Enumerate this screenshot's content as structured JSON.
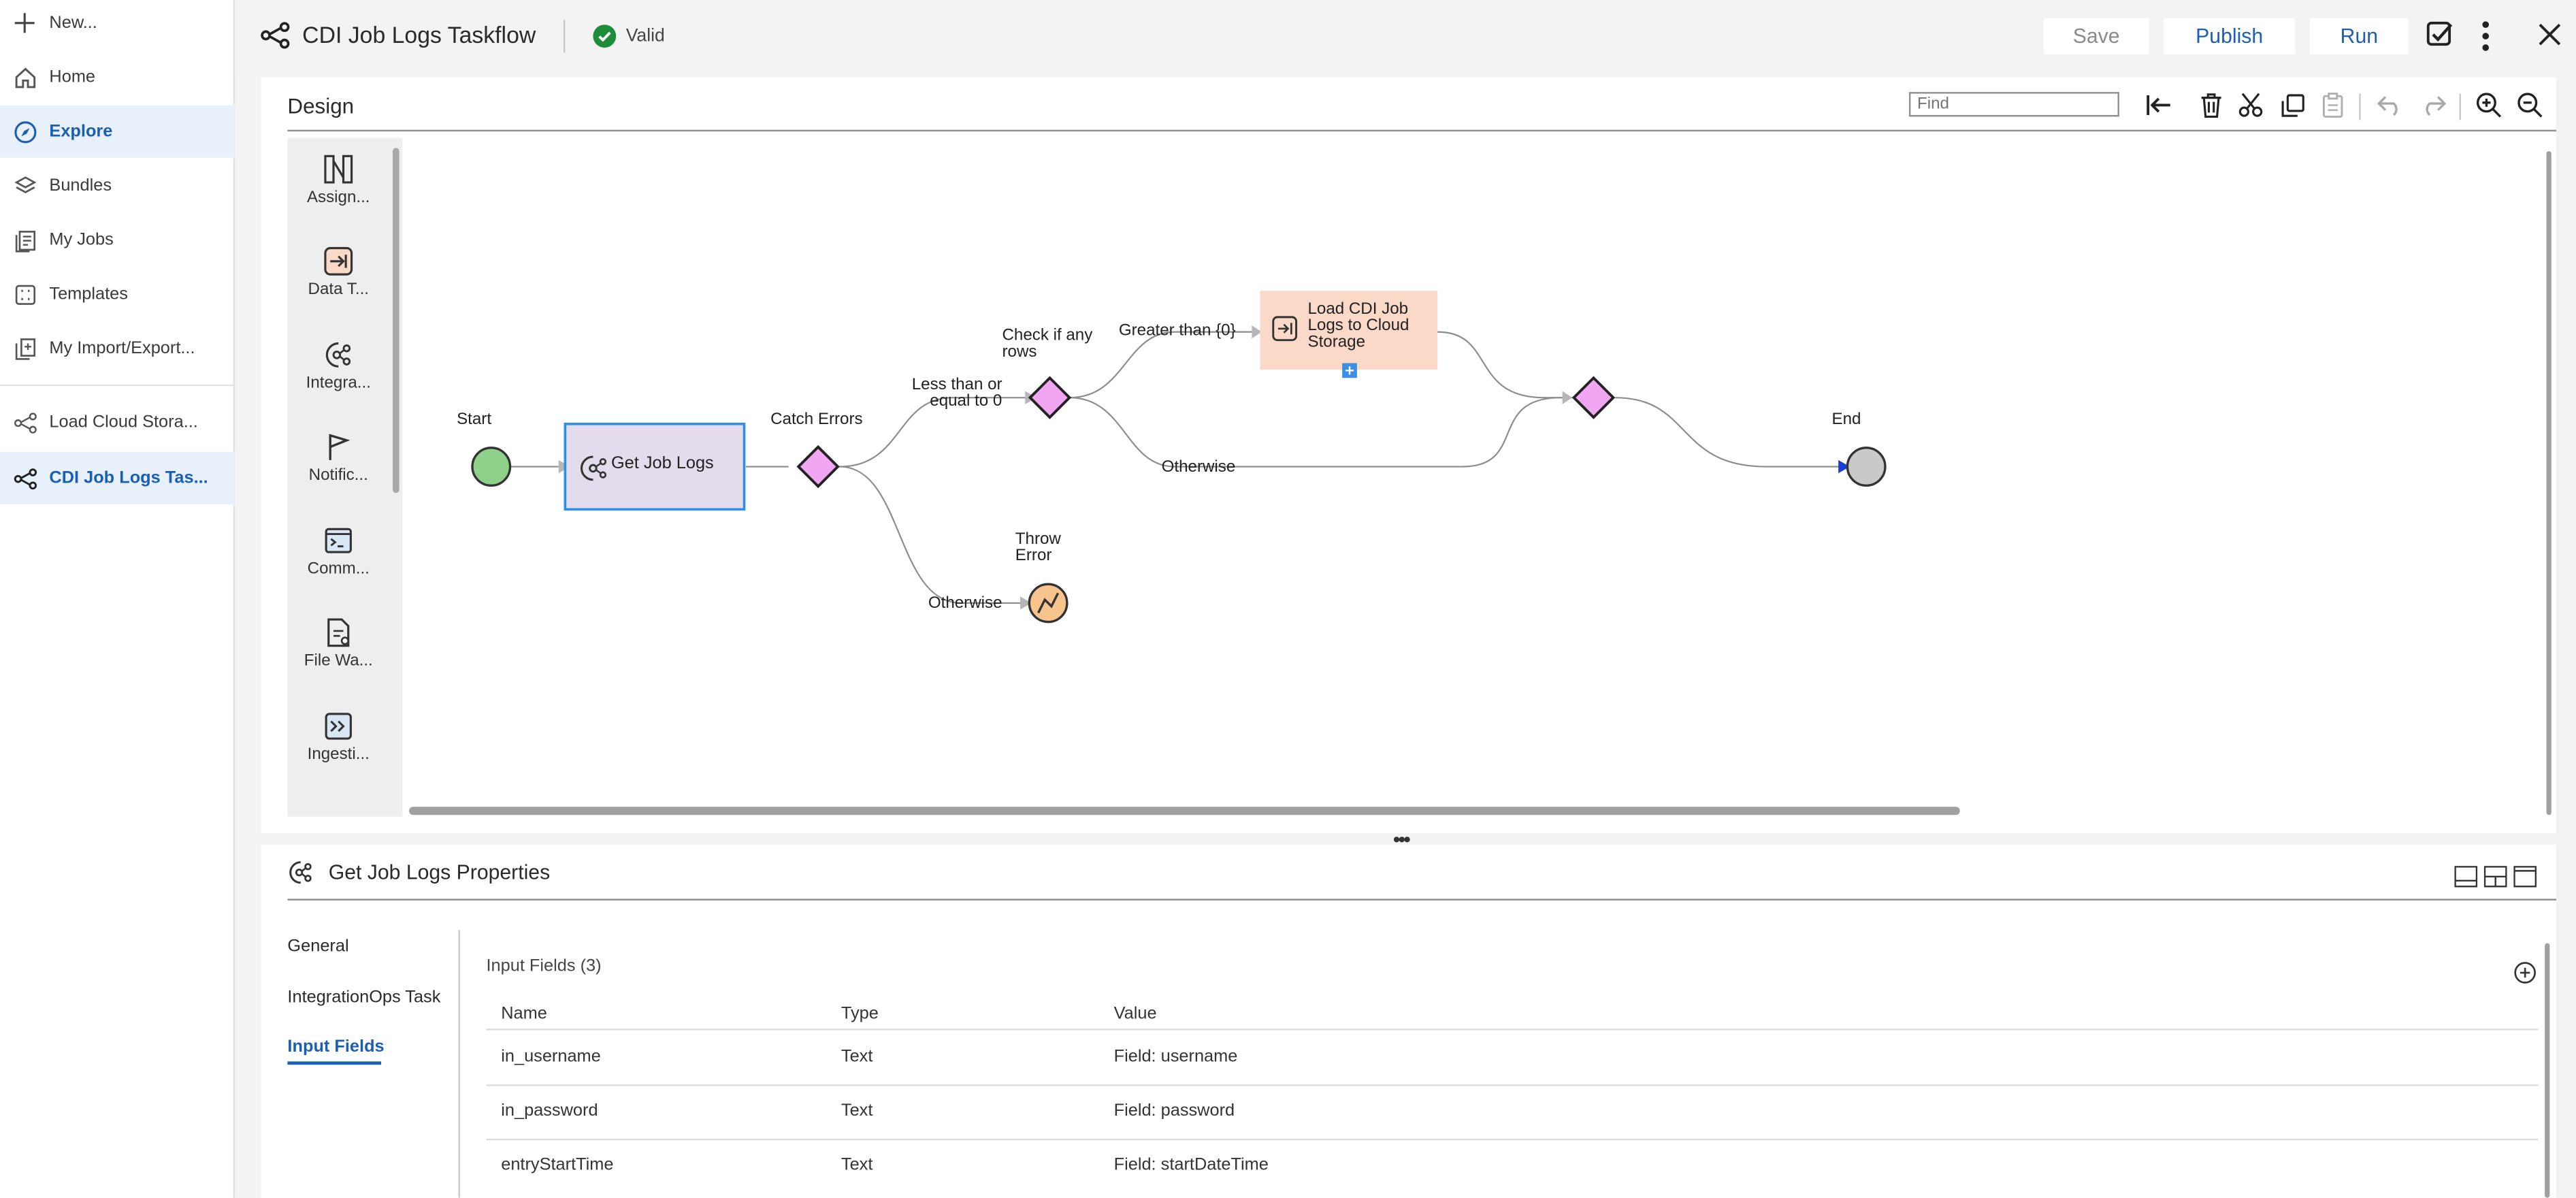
{
  "sidebar": {
    "items": [
      {
        "label": "New...",
        "icon": "plus-icon"
      },
      {
        "label": "Home",
        "icon": "home-icon"
      },
      {
        "label": "Explore",
        "icon": "compass-icon",
        "active": true
      },
      {
        "label": "Bundles",
        "icon": "layers-icon"
      },
      {
        "label": "My Jobs",
        "icon": "document-list-icon"
      },
      {
        "label": "Templates",
        "icon": "template-frame-icon"
      },
      {
        "label": "My Import/Export...",
        "icon": "import-export-icon"
      }
    ],
    "open_assets": [
      {
        "label": "Load Cloud Stora...",
        "icon": "taskflow-icon"
      },
      {
        "label": "CDI Job Logs Tas...",
        "icon": "taskflow-icon",
        "active": true
      }
    ]
  },
  "header": {
    "title": "CDI Job Logs Taskflow",
    "status": "Valid",
    "save_label": "Save",
    "publish_label": "Publish",
    "run_label": "Run"
  },
  "design": {
    "title": "Design",
    "find_placeholder": "Find",
    "palette": [
      {
        "label": "Assign...",
        "icon": "assignment-icon"
      },
      {
        "label": "Data T...",
        "icon": "data-task-icon"
      },
      {
        "label": "Integra...",
        "icon": "integration-icon"
      },
      {
        "label": "Notific...",
        "icon": "flag-icon"
      },
      {
        "label": "Comm...",
        "icon": "command-icon"
      },
      {
        "label": "File Wa...",
        "icon": "file-watch-icon"
      },
      {
        "label": "Ingesti...",
        "icon": "ingestion-icon"
      }
    ],
    "nodes": {
      "start": "Start",
      "get_job_logs": "Get Job Logs",
      "catch_errors": "Catch Errors",
      "check_rows_line1": "Check if any",
      "check_rows_line2": "rows",
      "load_line1": "Load CDI Job",
      "load_line2": "Logs to Cloud",
      "load_line3": "Storage",
      "throw_line1": "Throw",
      "throw_line2": "Error",
      "end": "End"
    },
    "edges": {
      "less_line1": "Less than or",
      "less_line2": "equal to 0",
      "greater": "Greater than {0}",
      "otherwise_top": "Otherwise",
      "otherwise_bottom": "Otherwise"
    }
  },
  "properties": {
    "title": "Get Job Logs Properties",
    "tabs": [
      "General",
      "IntegrationOps Task",
      "Input Fields"
    ],
    "active_tab": "Input Fields",
    "input_fields_title": "Input Fields (3)",
    "columns": [
      "Name",
      "Type",
      "Value"
    ],
    "rows": [
      {
        "name": "in_username",
        "type": "Text",
        "value": "Field: username"
      },
      {
        "name": "in_password",
        "type": "Text",
        "value": "Field: password"
      },
      {
        "name": "entryStartTime",
        "type": "Text",
        "value": "Field: startDateTime"
      }
    ]
  },
  "colors": {
    "accent": "#1b5fb5",
    "valid": "#1e8c3a",
    "start_node": "#8fd18b",
    "decision": "#f1a6f1",
    "data_task": "#fbd9c9",
    "selected_task": "#e2dcec",
    "throw": "#f8c48e"
  }
}
